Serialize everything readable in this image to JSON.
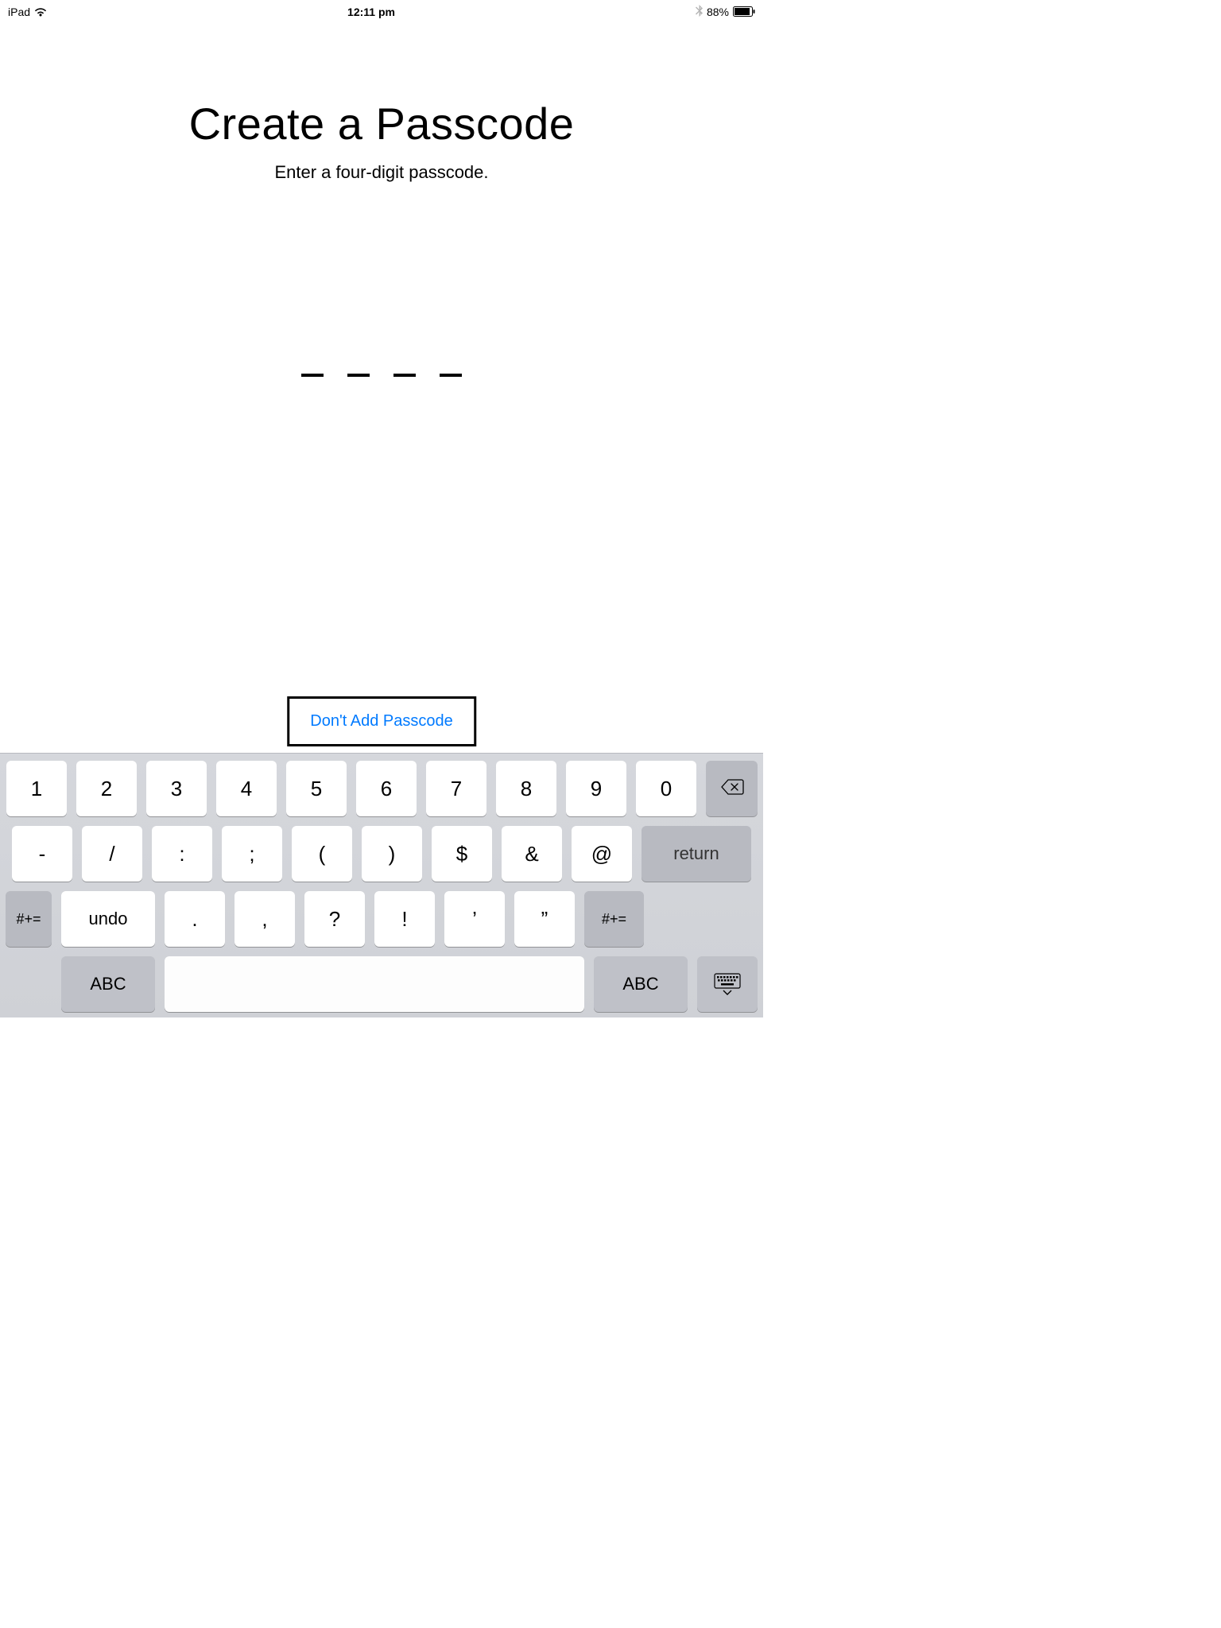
{
  "status_bar": {
    "device": "iPad",
    "time": "12:11 pm",
    "battery_pct": "88%"
  },
  "page": {
    "title": "Create a Passcode",
    "subtitle": "Enter a four-digit passcode.",
    "skip_label": "Don't Add Passcode"
  },
  "keyboard": {
    "row1": [
      "1",
      "2",
      "3",
      "4",
      "5",
      "6",
      "7",
      "8",
      "9",
      "0"
    ],
    "row2": [
      "-",
      "/",
      ":",
      ";",
      "(",
      ")",
      "$",
      "&",
      "@"
    ],
    "row2_return": "return",
    "row3_more": "#+=",
    "row3_undo": "undo",
    "row3": [
      ".",
      ",",
      "?",
      "!",
      "’",
      "”"
    ],
    "row4_abc": "ABC"
  }
}
